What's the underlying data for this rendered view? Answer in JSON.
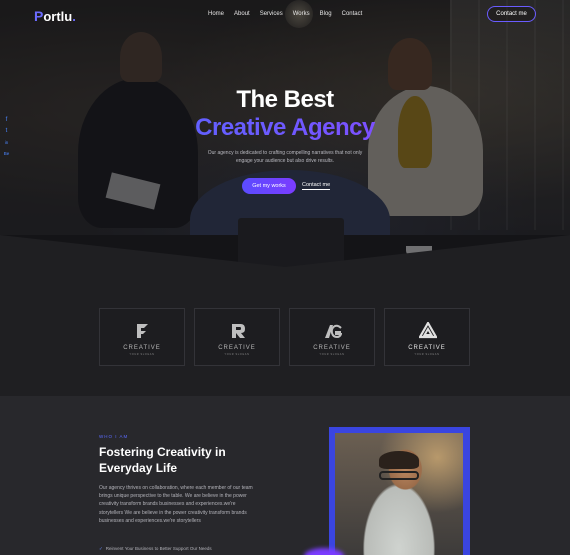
{
  "header": {
    "logo_text": "ortlu",
    "logo_letter": "P",
    "logo_dot": ".",
    "nav": [
      "Home",
      "About",
      "Services",
      "Works",
      "Blog",
      "Contact"
    ],
    "cta": "Contact me"
  },
  "hero": {
    "title_line1": "The Best",
    "title_line2": "Creative Agency",
    "description": "Our agency is dedicated to crafting compelling narratives that not only engage your audience but also drive results.",
    "primary_button": "Get my works",
    "secondary_link": "Contact me"
  },
  "social": {
    "icons": [
      "facebook-icon",
      "twitter-icon",
      "linkedin-icon",
      "behance-icon"
    ],
    "glyphs": [
      "f",
      "t",
      "in",
      "Be"
    ]
  },
  "clients": {
    "cards": [
      {
        "name": "CREATIVE",
        "sub": "YOUR SLOGAN"
      },
      {
        "name": "CREATIVE",
        "sub": "YOUR SLOGAN"
      },
      {
        "name": "CREATIVE",
        "sub": "YOUR SLOGAN"
      },
      {
        "name": "CREATIVE",
        "sub": "YOUR SLOGAN"
      }
    ]
  },
  "about": {
    "eyebrow": "WHO I AM",
    "title": "Fostering Creativity in Everyday Life",
    "text": "Our agency thrives on collaboration, where each member of our team brings unique perspective to the table. We are believe in the power creativity transform brands businesses and experiences.we're storytellers We are believe in the power creativity transform brands businesses and experiences.we're storytellers",
    "check_item": "Reinvent Your Business to Better Support Our Needs"
  },
  "colors": {
    "accent": "#5b4cff",
    "accent_purple": "#7b3cff",
    "background": "#1f1f22"
  }
}
